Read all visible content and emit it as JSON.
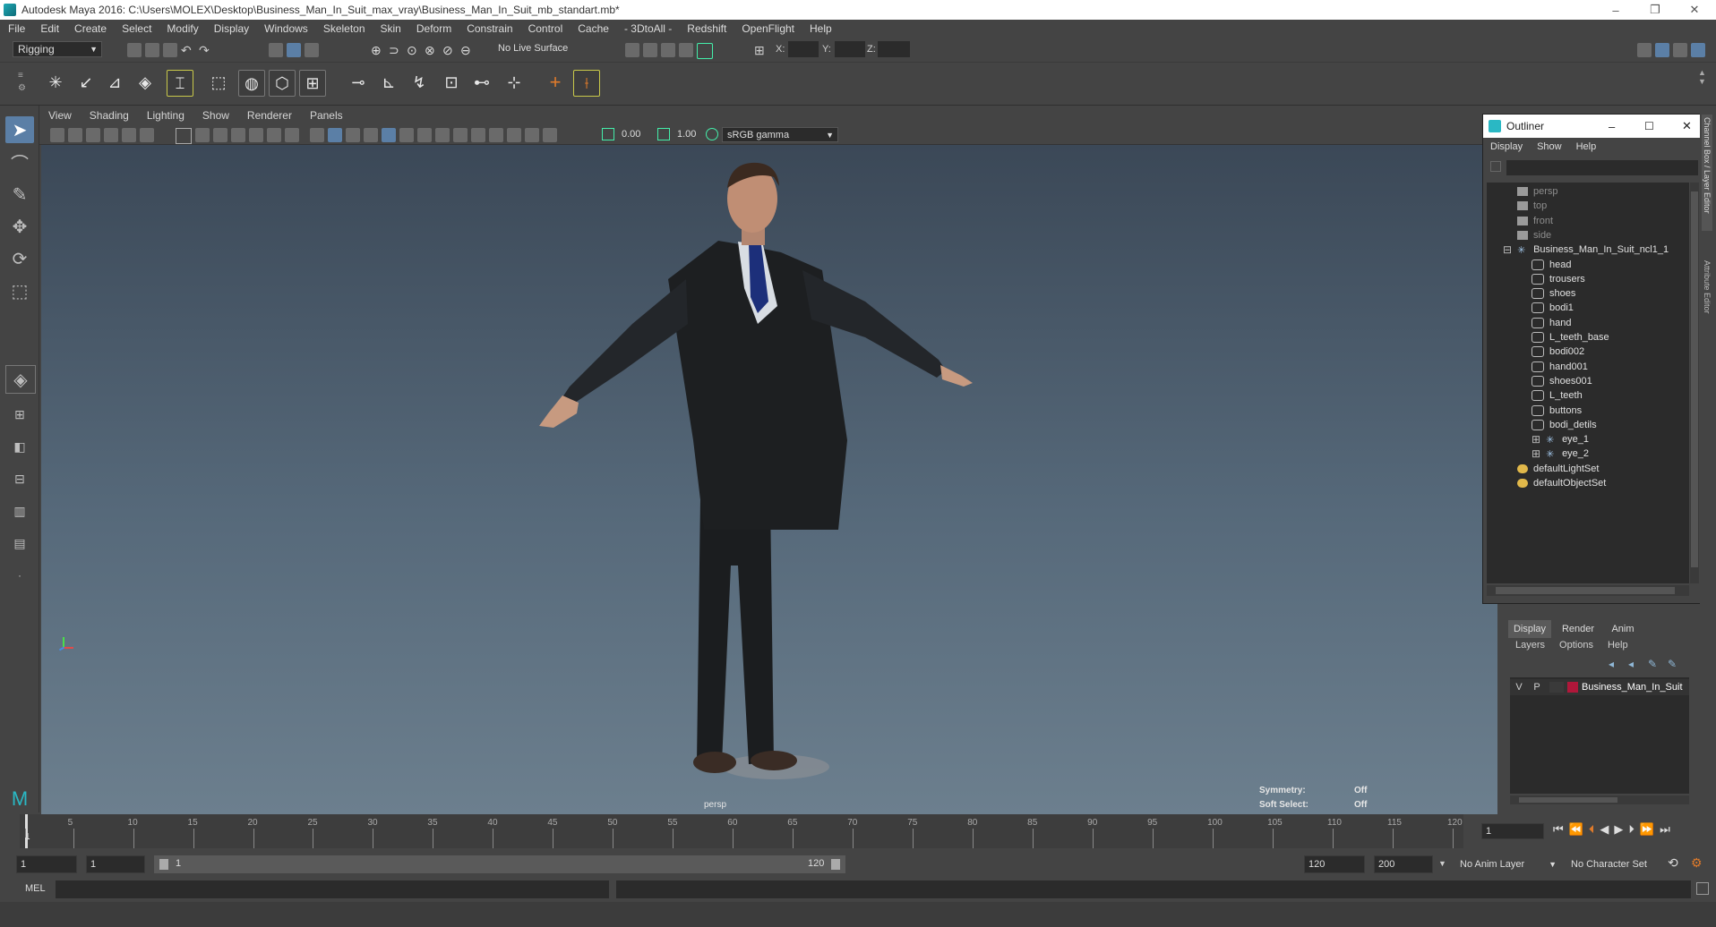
{
  "window": {
    "title": "Autodesk Maya 2016: C:\\Users\\MOLEX\\Desktop\\Business_Man_In_Suit_max_vray\\Business_Man_In_Suit_mb_standart.mb*",
    "minimize": "–",
    "maximize": "❐",
    "close": "✕"
  },
  "menubar": [
    "File",
    "Edit",
    "Create",
    "Select",
    "Modify",
    "Display",
    "Windows",
    "Skeleton",
    "Skin",
    "Deform",
    "Constrain",
    "Control",
    "Cache",
    "- 3DtoAll -",
    "Redshift",
    "OpenFlight",
    "Help"
  ],
  "toolbar": {
    "mode": "Rigging",
    "live_surface": "No Live Surface",
    "x_label": "X:",
    "y_label": "Y:",
    "z_label": "Z:"
  },
  "panel_menu": [
    "View",
    "Shading",
    "Lighting",
    "Show",
    "Renderer",
    "Panels"
  ],
  "panel_toolbar": {
    "exposure": "0.00",
    "gamma": "1.00",
    "color_space": "sRGB gamma"
  },
  "viewport": {
    "camera": "persp",
    "symmetry_label": "Symmetry:",
    "symmetry_value": "Off",
    "soft_select_label": "Soft Select:",
    "soft_select_value": "Off"
  },
  "outliner": {
    "title": "Outliner",
    "menu": [
      "Display",
      "Show",
      "Help"
    ],
    "items": [
      {
        "label": "persp",
        "type": "camera"
      },
      {
        "label": "top",
        "type": "camera"
      },
      {
        "label": "front",
        "type": "camera"
      },
      {
        "label": "side",
        "type": "camera"
      },
      {
        "label": "Business_Man_In_Suit_ncl1_1",
        "type": "group"
      },
      {
        "label": "head",
        "type": "mesh"
      },
      {
        "label": "trousers",
        "type": "mesh"
      },
      {
        "label": "shoes",
        "type": "mesh"
      },
      {
        "label": "bodi1",
        "type": "mesh"
      },
      {
        "label": "hand",
        "type": "mesh"
      },
      {
        "label": "L_teeth_base",
        "type": "mesh"
      },
      {
        "label": "bodi002",
        "type": "mesh"
      },
      {
        "label": "hand001",
        "type": "mesh"
      },
      {
        "label": "shoes001",
        "type": "mesh"
      },
      {
        "label": "L_teeth",
        "type": "mesh"
      },
      {
        "label": "buttons",
        "type": "mesh"
      },
      {
        "label": "bodi_detils",
        "type": "mesh"
      },
      {
        "label": "eye_1",
        "type": "group"
      },
      {
        "label": "eye_2",
        "type": "group"
      },
      {
        "label": "defaultLightSet",
        "type": "set"
      },
      {
        "label": "defaultObjectSet",
        "type": "set"
      }
    ]
  },
  "layer_editor": {
    "tabs": [
      "Display",
      "Render",
      "Anim"
    ],
    "menu": [
      "Layers",
      "Options",
      "Help"
    ],
    "layer": {
      "v": "V",
      "p": "P",
      "name": "Business_Man_In_Suit",
      "color": "#b0173a"
    }
  },
  "side_tabs": [
    "Channel Box / Layer Editor",
    "Attribute Editor"
  ],
  "timeline": {
    "ticks": [
      "5",
      "10",
      "15",
      "20",
      "25",
      "30",
      "35",
      "40",
      "45",
      "50",
      "55",
      "60",
      "65",
      "70",
      "75",
      "80",
      "85",
      "90",
      "95",
      "100",
      "105",
      "110",
      "115",
      "120"
    ],
    "start_tick": "1",
    "current_frame": "1"
  },
  "range": {
    "start": "1",
    "playback_start": "1",
    "slider_start": "1",
    "slider_end": "120",
    "playback_end": "120",
    "end": "200",
    "anim_layer": "No Anim Layer",
    "character_set": "No Character Set"
  },
  "command": {
    "label": "MEL"
  }
}
